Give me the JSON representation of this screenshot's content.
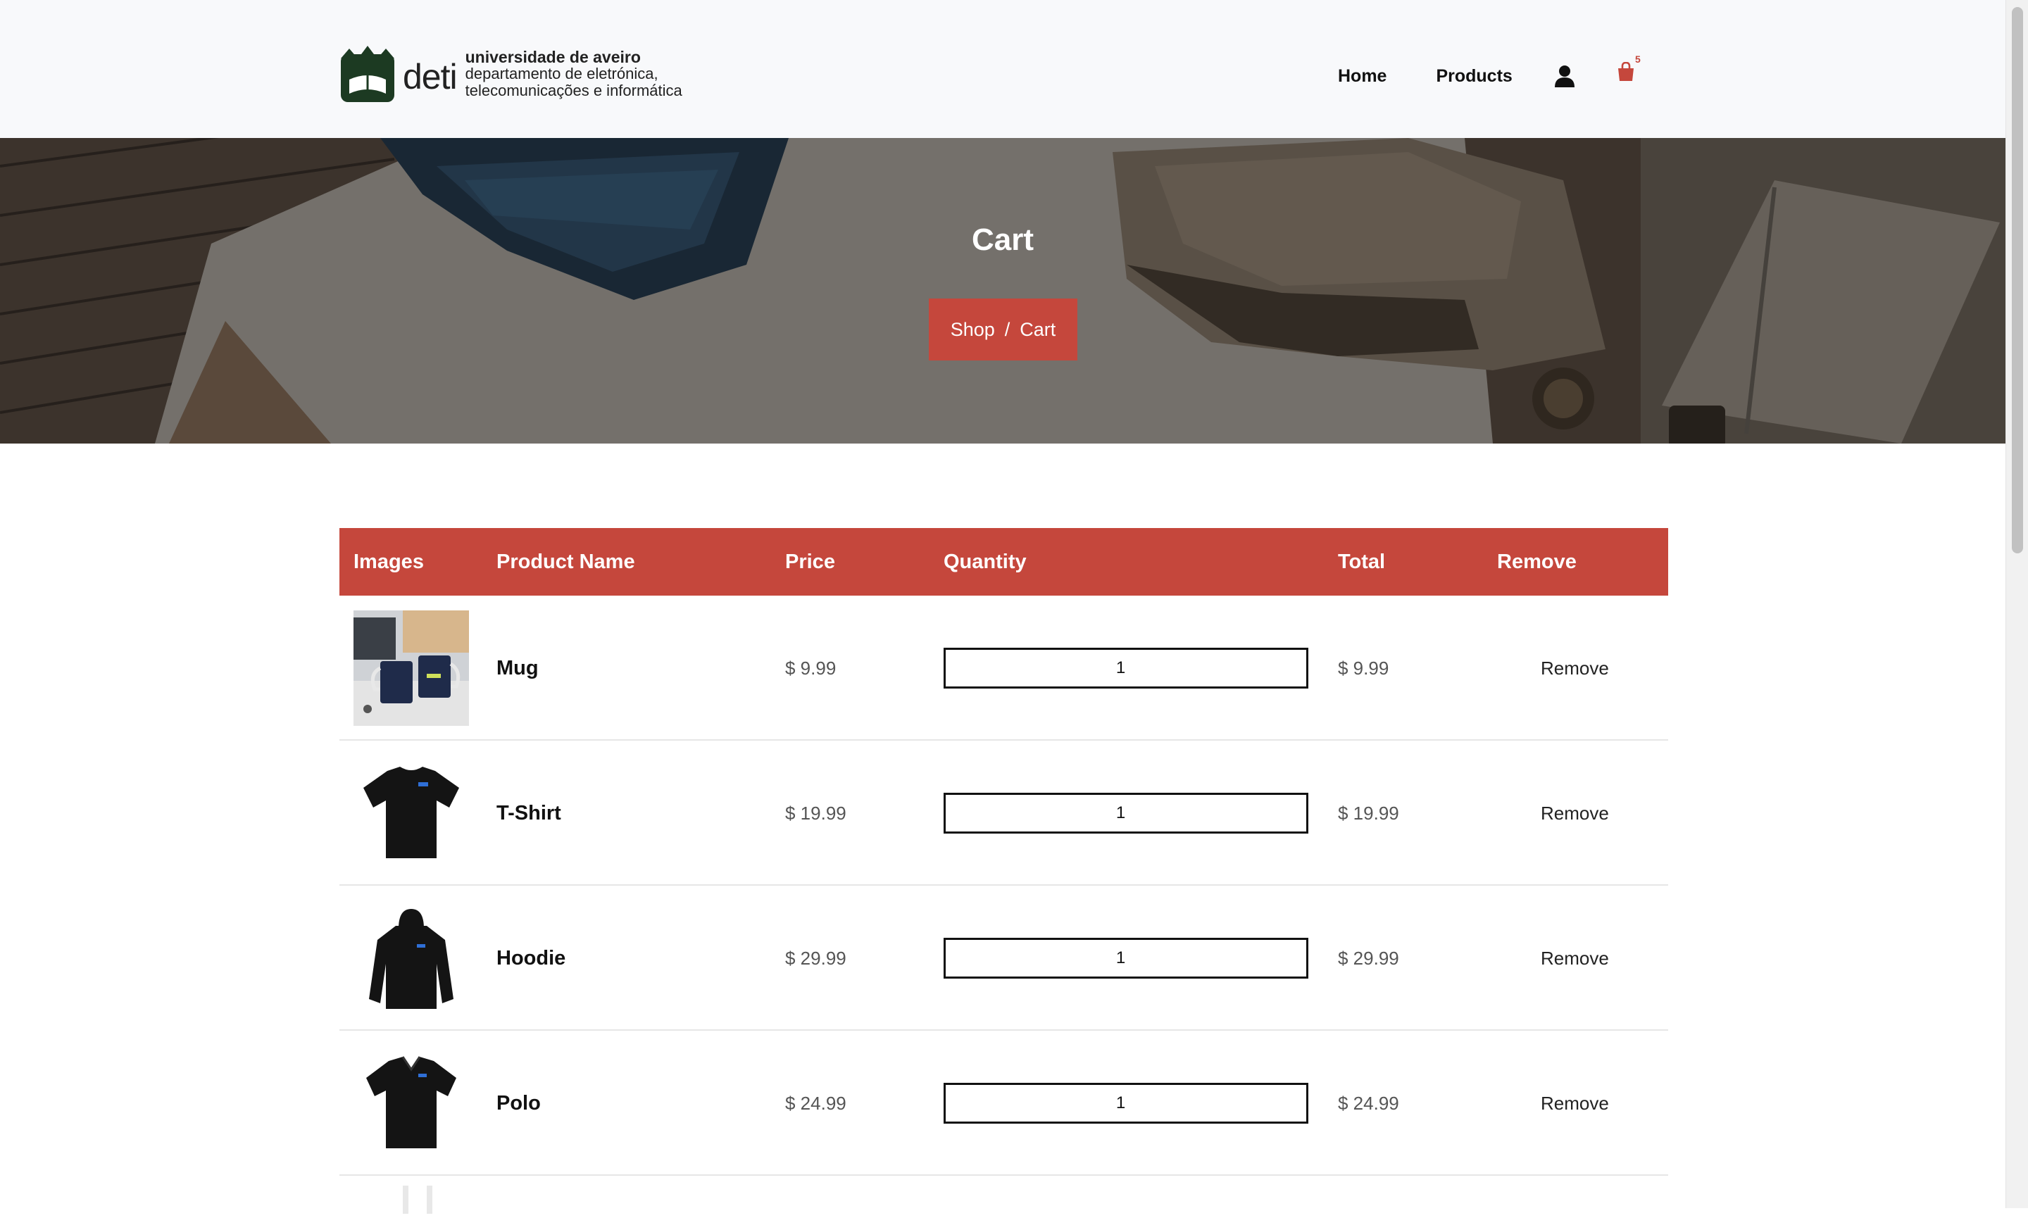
{
  "header": {
    "logo": {
      "word": "deti",
      "line1": "universidade de aveiro",
      "line2": "departamento de eletrónica,",
      "line3": "telecomunicações e informática"
    },
    "nav": {
      "home": "Home",
      "products": "Products",
      "cart_count": "5"
    }
  },
  "hero": {
    "title": "Cart",
    "breadcrumb": {
      "shop": "Shop",
      "separator": "/",
      "current": "Cart"
    }
  },
  "table": {
    "headers": {
      "images": "Images",
      "name": "Product Name",
      "price": "Price",
      "quantity": "Quantity",
      "total": "Total",
      "remove": "Remove"
    },
    "rows": [
      {
        "name": "Mug",
        "price": "$ 9.99",
        "quantity": "1",
        "total": "$ 9.99",
        "remove": "Remove"
      },
      {
        "name": "T-Shirt",
        "price": "$ 19.99",
        "quantity": "1",
        "total": "$ 19.99",
        "remove": "Remove"
      },
      {
        "name": "Hoodie",
        "price": "$ 29.99",
        "quantity": "1",
        "total": "$ 29.99",
        "remove": "Remove"
      },
      {
        "name": "Polo",
        "price": "$ 24.99",
        "quantity": "1",
        "total": "$ 24.99",
        "remove": "Remove"
      }
    ]
  },
  "colors": {
    "accent": "#c5473c",
    "header_bg": "#f8f9fb",
    "logo_green": "#1c3a22"
  },
  "icons": {
    "user": "user-icon",
    "cart": "shopping-bag-icon"
  }
}
